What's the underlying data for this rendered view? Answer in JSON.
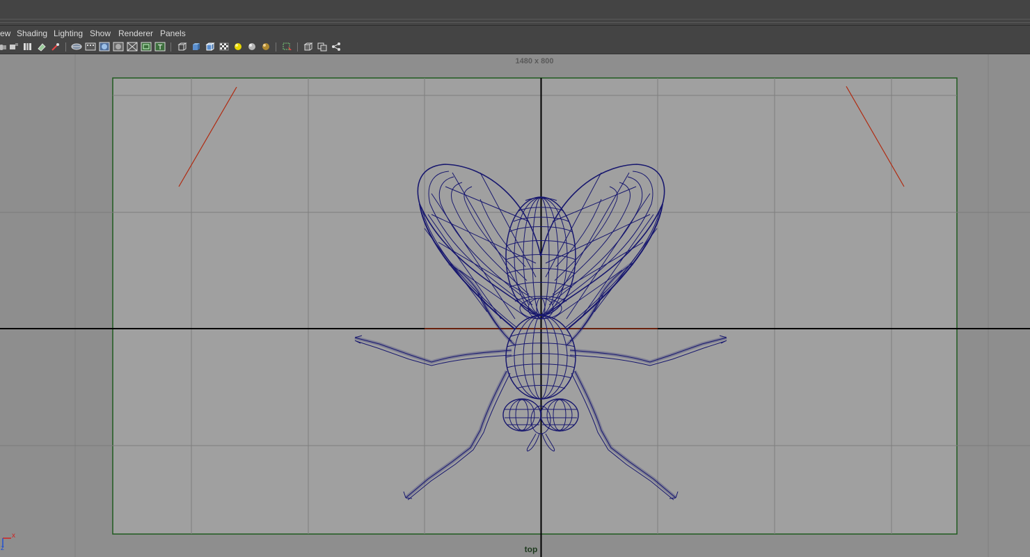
{
  "menu": {
    "items": [
      {
        "label": "ew"
      },
      {
        "label": "Shading"
      },
      {
        "label": "Lighting"
      },
      {
        "label": "Show"
      },
      {
        "label": "Renderer"
      },
      {
        "label": "Panels"
      }
    ]
  },
  "toolbar": {
    "icons": [
      "select-camera-icon",
      "camera-attributes-icon",
      "bookmarks-icon",
      "image-plane-icon",
      "two-d-pan-zoom-icon",
      "grease-pencil-icon",
      "grid-icon",
      "film-gate-icon",
      "resolution-gate-icon",
      "gate-mask-icon",
      "field-chart-icon",
      "safe-action-icon",
      "safe-title-icon",
      "wireframe-icon",
      "smooth-shade-icon",
      "wireframe-on-shaded-icon",
      "textured-icon",
      "use-all-lights-icon",
      "shadows-icon",
      "ambient-occlusion-icon",
      "isolate-select-icon",
      "xray-icon",
      "xray-active-icon",
      "xray-joints-icon"
    ]
  },
  "viewport": {
    "resolution_label": "1480 x 800",
    "camera_label": "top",
    "axis": {
      "x_label": "x",
      "z_label": "z"
    },
    "colors": {
      "background": "#8e8e8e",
      "gate_fill": "#a0a0a0",
      "gate_border": "#1f5a1f",
      "grid_line": "#7e7e7e",
      "axis_line": "#000000",
      "safe_marker": "#b02a10",
      "wireframe": "#17176e"
    },
    "model": {
      "type": "fly",
      "display": "wireframe"
    }
  }
}
